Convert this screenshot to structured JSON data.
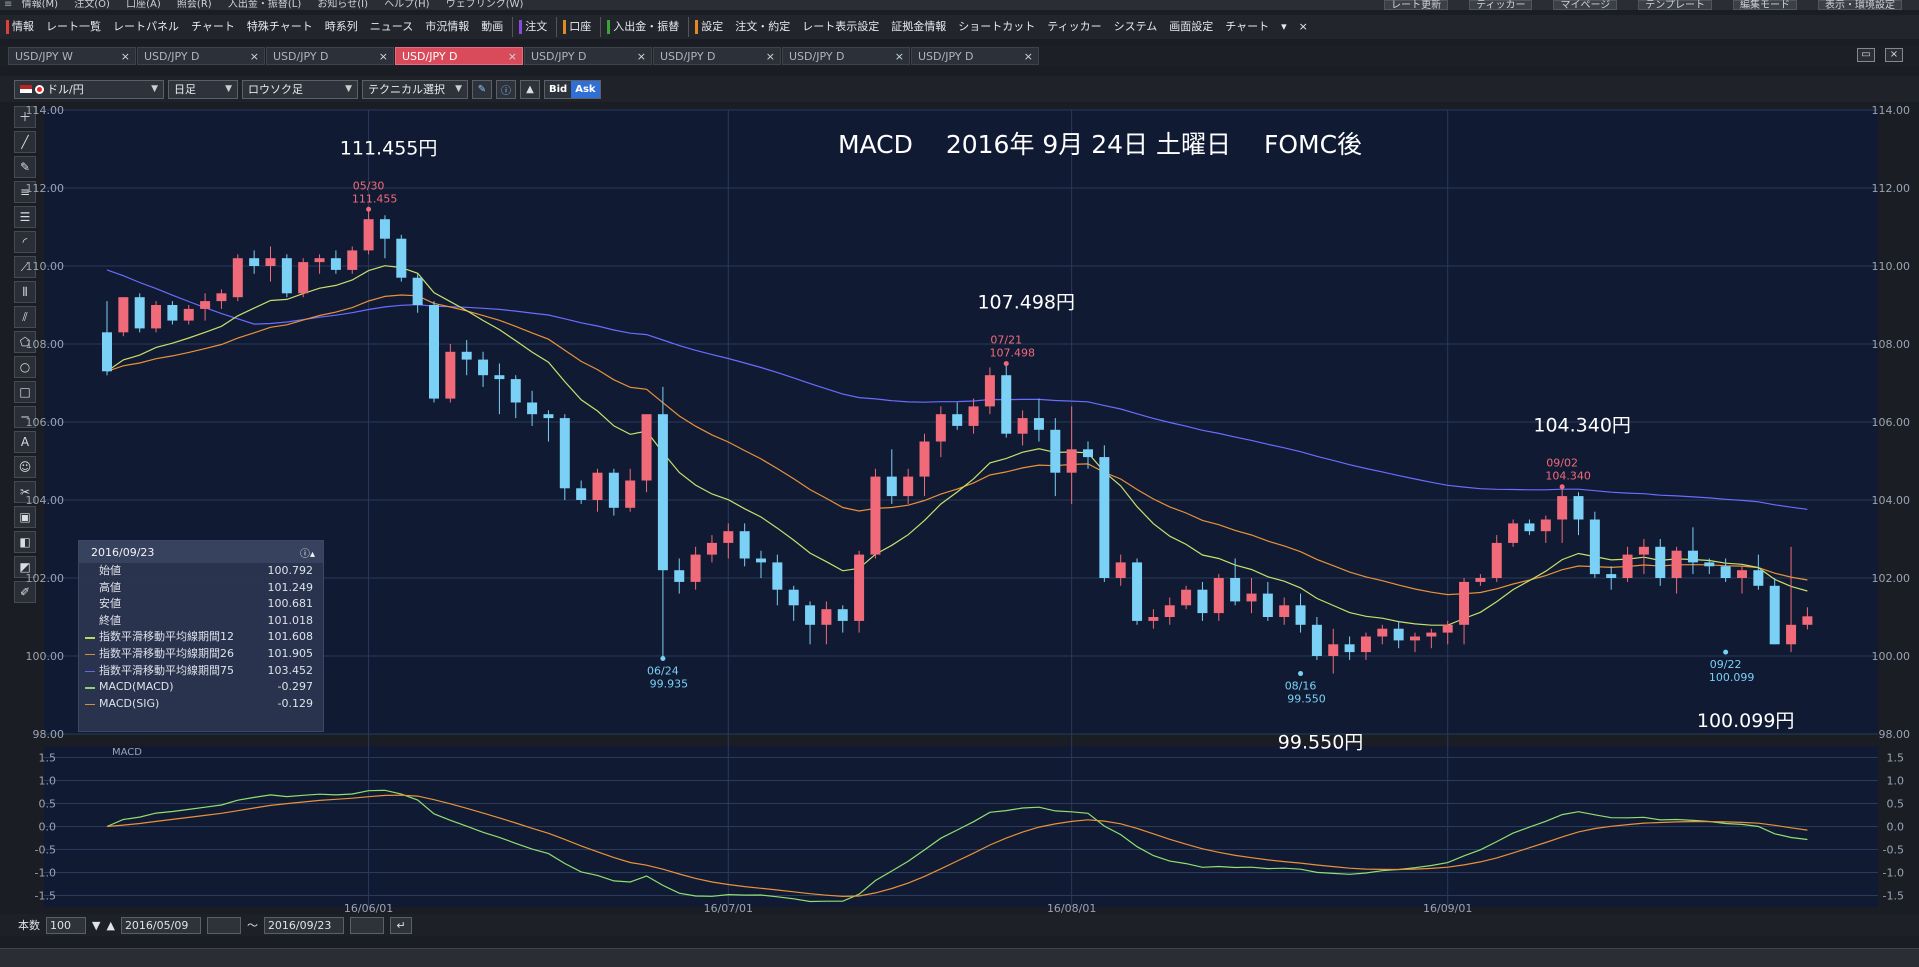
{
  "menubar": {
    "items": [
      "情報(M)",
      "注文(O)",
      "口座(A)",
      "照会(R)",
      "入出金・振替(L)",
      "お知らせ(I)",
      "ヘルプ(H)",
      "ウェブリンク(W)"
    ],
    "right": [
      "レート更新",
      "ティッカー",
      "マイページ",
      "テンプレート",
      "編集モード",
      "表示・環境設定"
    ]
  },
  "toolbar": {
    "items": [
      {
        "label": "情報",
        "color": "#e0403a"
      },
      {
        "label": "レート一覧"
      },
      {
        "label": "レートパネル"
      },
      {
        "label": "チャート"
      },
      {
        "label": "特殊チャート"
      },
      {
        "label": "時系列"
      },
      {
        "label": "ニュース"
      },
      {
        "label": "市況情報"
      },
      {
        "label": "動画"
      },
      {
        "label": "注文",
        "color": "#8a4ad9",
        "sep": true
      },
      {
        "label": "口座",
        "color": "#e08a20",
        "sep": true
      },
      {
        "label": "入出金・振替",
        "color": "#3aa43a",
        "sep": true
      },
      {
        "label": "設定",
        "color": "#e08a20",
        "sep": true
      },
      {
        "label": "注文・約定"
      },
      {
        "label": "レート表示設定"
      },
      {
        "label": "証拠金情報"
      },
      {
        "label": "ショートカット"
      },
      {
        "label": "ティッカー"
      },
      {
        "label": "システム"
      },
      {
        "label": "画面設定"
      },
      {
        "label": "チャート"
      },
      {
        "label": "▾"
      },
      {
        "label": "×"
      }
    ]
  },
  "tabs": [
    {
      "label": "USD/JPY W",
      "active": false
    },
    {
      "label": "USD/JPY D",
      "active": false
    },
    {
      "label": "USD/JPY D",
      "active": false
    },
    {
      "label": "USD/JPY D",
      "active": true
    },
    {
      "label": "USD/JPY D",
      "active": false
    },
    {
      "label": "USD/JPY D",
      "active": false
    },
    {
      "label": "USD/JPY D",
      "active": false
    },
    {
      "label": "USD/JPY D",
      "active": false
    }
  ],
  "controls": {
    "pair": "ドル/円",
    "period": "日足",
    "chart_type": "ロウソク足",
    "technical": "テクニカル選択",
    "bid": "Bid",
    "ask": "Ask"
  },
  "tools": [
    "＋",
    "╱",
    "✎",
    "≡",
    "☰",
    "◜",
    "⟋",
    "⦀",
    "⫽",
    "⬠",
    "○",
    "□",
    "─",
    "A",
    "☺",
    "✂",
    "▣",
    "◧",
    "◩",
    "✐"
  ],
  "info": {
    "date": "2016/09/23",
    "rows": [
      {
        "label": "始値",
        "value": "100.792",
        "color": ""
      },
      {
        "label": "高値",
        "value": "101.249",
        "color": ""
      },
      {
        "label": "安値",
        "value": "100.681",
        "color": ""
      },
      {
        "label": "終値",
        "value": "101.018",
        "color": ""
      },
      {
        "label": "指数平滑移動平均線期間12",
        "value": "101.608",
        "color": "#c8e06a"
      },
      {
        "label": "指数平滑移動平均線期間26",
        "value": "101.905",
        "color": "#e8923a"
      },
      {
        "label": "指数平滑移動平均線期間75",
        "value": "103.452",
        "color": "#6a6cff"
      },
      {
        "label": "MACD(MACD)",
        "value": "-0.297",
        "color": "#8fe070"
      },
      {
        "label": "MACD(SIG)",
        "value": "-0.129",
        "color": "#e8923a"
      }
    ]
  },
  "bottom": {
    "count_label": "本数",
    "count": "100",
    "from": "2016/05/09",
    "tilde": "～",
    "to": "2016/09/23"
  },
  "chart_data": {
    "type": "candlestick",
    "title": "MACD　 2016年 9月 24日 土曜日　 FOMC後",
    "ylim": [
      98,
      114
    ],
    "yticks": [
      "114.00",
      "112.00",
      "110.00",
      "108.00",
      "106.00",
      "104.00",
      "102.00",
      "100.00",
      "98.00"
    ],
    "xticks": [
      {
        "label": "16/06/01",
        "i": 16
      },
      {
        "label": "16/07/01",
        "i": 38
      },
      {
        "label": "16/08/01",
        "i": 59
      },
      {
        "label": "16/09/01",
        "i": 82
      }
    ],
    "colors": {
      "up": "#f06a7a",
      "down": "#7ad0f5",
      "ema12": "#c8e06a",
      "ema26": "#e8923a",
      "ema75": "#6a6cff",
      "macd": "#8fe070",
      "sig": "#e8923a",
      "grid": "#2a3a5a",
      "bg": "#101a33"
    },
    "candles": [
      [
        108.3,
        109.1,
        107.2,
        107.3
      ],
      [
        108.3,
        109.2,
        108.2,
        109.2
      ],
      [
        109.2,
        109.3,
        108.3,
        108.4
      ],
      [
        108.4,
        109.1,
        108.3,
        109.0
      ],
      [
        109.0,
        109.1,
        108.5,
        108.6
      ],
      [
        108.6,
        109.0,
        108.5,
        108.9
      ],
      [
        108.9,
        109.3,
        108.6,
        109.1
      ],
      [
        109.1,
        109.4,
        108.9,
        109.3
      ],
      [
        109.2,
        110.3,
        109.1,
        110.2
      ],
      [
        110.2,
        110.4,
        109.8,
        110.0
      ],
      [
        110.0,
        110.5,
        109.6,
        110.2
      ],
      [
        110.2,
        110.3,
        109.2,
        109.3
      ],
      [
        109.3,
        110.2,
        109.2,
        110.1
      ],
      [
        110.1,
        110.3,
        109.8,
        110.2
      ],
      [
        110.2,
        110.4,
        109.8,
        109.9
      ],
      [
        109.9,
        110.5,
        109.8,
        110.4
      ],
      [
        110.4,
        111.455,
        110.3,
        111.2
      ],
      [
        111.2,
        111.3,
        110.2,
        110.7
      ],
      [
        110.7,
        110.8,
        109.6,
        109.7
      ],
      [
        109.7,
        109.8,
        108.8,
        109.0
      ],
      [
        109.0,
        109.1,
        106.5,
        106.6
      ],
      [
        106.6,
        108.0,
        106.5,
        107.8
      ],
      [
        107.8,
        108.1,
        107.2,
        107.6
      ],
      [
        107.6,
        107.8,
        106.9,
        107.2
      ],
      [
        107.2,
        107.5,
        106.2,
        107.1
      ],
      [
        107.1,
        107.2,
        106.1,
        106.5
      ],
      [
        106.5,
        106.8,
        105.9,
        106.2
      ],
      [
        106.2,
        106.3,
        105.5,
        106.1
      ],
      [
        106.1,
        106.2,
        104.0,
        104.3
      ],
      [
        104.3,
        104.5,
        103.9,
        104.0
      ],
      [
        104.0,
        104.8,
        103.7,
        104.7
      ],
      [
        104.7,
        104.8,
        103.6,
        103.8
      ],
      [
        103.8,
        104.8,
        103.7,
        104.5
      ],
      [
        104.5,
        105.3,
        104.2,
        106.2
      ],
      [
        106.2,
        106.9,
        99.935,
        102.2
      ],
      [
        102.2,
        102.5,
        101.6,
        101.9
      ],
      [
        101.9,
        102.8,
        101.7,
        102.6
      ],
      [
        102.6,
        103.1,
        102.4,
        102.9
      ],
      [
        102.9,
        103.4,
        102.5,
        103.2
      ],
      [
        103.2,
        103.4,
        102.3,
        102.5
      ],
      [
        102.5,
        102.7,
        102.0,
        102.4
      ],
      [
        102.4,
        102.6,
        101.3,
        101.7
      ],
      [
        101.7,
        101.8,
        100.9,
        101.3
      ],
      [
        101.3,
        101.4,
        100.3,
        100.8
      ],
      [
        100.8,
        101.4,
        100.3,
        101.2
      ],
      [
        101.2,
        101.3,
        100.6,
        100.9
      ],
      [
        100.9,
        102.7,
        100.6,
        102.6
      ],
      [
        102.6,
        104.8,
        102.5,
        104.6
      ],
      [
        104.6,
        105.3,
        103.9,
        104.1
      ],
      [
        104.1,
        104.8,
        103.9,
        104.6
      ],
      [
        104.6,
        105.7,
        104.1,
        105.5
      ],
      [
        105.5,
        106.4,
        105.1,
        106.2
      ],
      [
        106.2,
        106.5,
        105.8,
        105.9
      ],
      [
        105.9,
        106.6,
        105.7,
        106.4
      ],
      [
        106.4,
        107.4,
        106.2,
        107.2
      ],
      [
        107.2,
        107.498,
        105.6,
        105.7
      ],
      [
        105.7,
        106.3,
        105.4,
        106.1
      ],
      [
        106.1,
        106.6,
        105.5,
        105.8
      ],
      [
        105.8,
        106.1,
        104.1,
        104.7
      ],
      [
        104.7,
        106.4,
        103.9,
        105.3
      ],
      [
        105.3,
        105.5,
        104.8,
        105.1
      ],
      [
        105.1,
        105.4,
        101.9,
        102.0
      ],
      [
        102.0,
        102.6,
        101.8,
        102.4
      ],
      [
        102.4,
        102.5,
        100.8,
        100.9
      ],
      [
        100.9,
        101.2,
        100.7,
        101.0
      ],
      [
        101.0,
        101.5,
        100.8,
        101.3
      ],
      [
        101.3,
        101.8,
        101.2,
        101.7
      ],
      [
        101.7,
        101.9,
        100.9,
        101.1
      ],
      [
        101.1,
        102.1,
        100.9,
        102.0
      ],
      [
        102.0,
        102.5,
        101.3,
        101.4
      ],
      [
        101.4,
        102.0,
        101.1,
        101.6
      ],
      [
        101.6,
        101.9,
        100.9,
        101.0
      ],
      [
        101.0,
        101.5,
        100.8,
        101.3
      ],
      [
        101.3,
        101.6,
        100.6,
        100.8
      ],
      [
        100.8,
        101.0,
        99.9,
        100.0
      ],
      [
        100.0,
        100.7,
        99.55,
        100.3
      ],
      [
        100.3,
        100.5,
        99.9,
        100.1
      ],
      [
        100.1,
        100.6,
        99.9,
        100.5
      ],
      [
        100.5,
        100.8,
        100.3,
        100.7
      ],
      [
        100.7,
        100.9,
        100.2,
        100.4
      ],
      [
        100.4,
        100.6,
        100.1,
        100.5
      ],
      [
        100.5,
        100.7,
        100.2,
        100.6
      ],
      [
        100.6,
        100.9,
        100.3,
        100.8
      ],
      [
        100.8,
        102.0,
        100.3,
        101.9
      ],
      [
        101.9,
        102.1,
        101.8,
        102.0
      ],
      [
        102.0,
        103.1,
        101.9,
        102.9
      ],
      [
        102.9,
        103.5,
        102.8,
        103.4
      ],
      [
        103.4,
        103.5,
        103.1,
        103.2
      ],
      [
        103.2,
        103.6,
        102.9,
        103.5
      ],
      [
        103.5,
        104.34,
        102.9,
        104.1
      ],
      [
        104.1,
        104.2,
        103.1,
        103.5
      ],
      [
        103.5,
        103.7,
        102.0,
        102.1
      ],
      [
        102.1,
        102.3,
        101.7,
        102.0
      ],
      [
        102.0,
        102.8,
        101.9,
        102.6
      ],
      [
        102.6,
        103.0,
        102.1,
        102.8
      ],
      [
        102.8,
        103.0,
        101.8,
        102.0
      ],
      [
        102.0,
        102.8,
        101.6,
        102.7
      ],
      [
        102.7,
        103.3,
        102.1,
        102.4
      ],
      [
        102.4,
        102.5,
        102.1,
        102.3
      ],
      [
        102.3,
        102.5,
        101.9,
        102.0
      ],
      [
        102.0,
        102.3,
        101.6,
        102.2
      ],
      [
        102.2,
        102.6,
        101.7,
        101.8
      ],
      [
        101.8,
        102.0,
        100.3,
        100.3
      ],
      [
        100.3,
        102.8,
        100.099,
        100.8
      ],
      [
        100.8,
        101.249,
        100.681,
        101.018
      ]
    ],
    "annotations": [
      {
        "i": 16,
        "value": 111.455,
        "date": "05/30",
        "label": "111.455",
        "big": "111.455円",
        "type": "high"
      },
      {
        "i": 34,
        "value": 99.935,
        "date": "06/24",
        "label": "99.935",
        "type": "low"
      },
      {
        "i": 55,
        "value": 107.498,
        "date": "07/21",
        "label": "107.498",
        "big": "107.498円",
        "type": "high"
      },
      {
        "i": 73,
        "value": 99.55,
        "date": "08/16",
        "label": "99.550",
        "big": "99.550円",
        "type": "low"
      },
      {
        "i": 89,
        "value": 104.34,
        "date": "09/02",
        "label": "104.340",
        "big": "104.340円",
        "type": "high"
      },
      {
        "i": 99,
        "value": 100.099,
        "date": "09/22",
        "label": "100.099",
        "big": "100.099円",
        "type": "low"
      }
    ],
    "macd_panel": {
      "title": "MACD",
      "ylim": [
        -1.75,
        1.75
      ],
      "yticks": [
        "1.5",
        "1.0",
        "0.5",
        "0.0",
        "-0.5",
        "-1.0",
        "-1.5"
      ]
    }
  }
}
